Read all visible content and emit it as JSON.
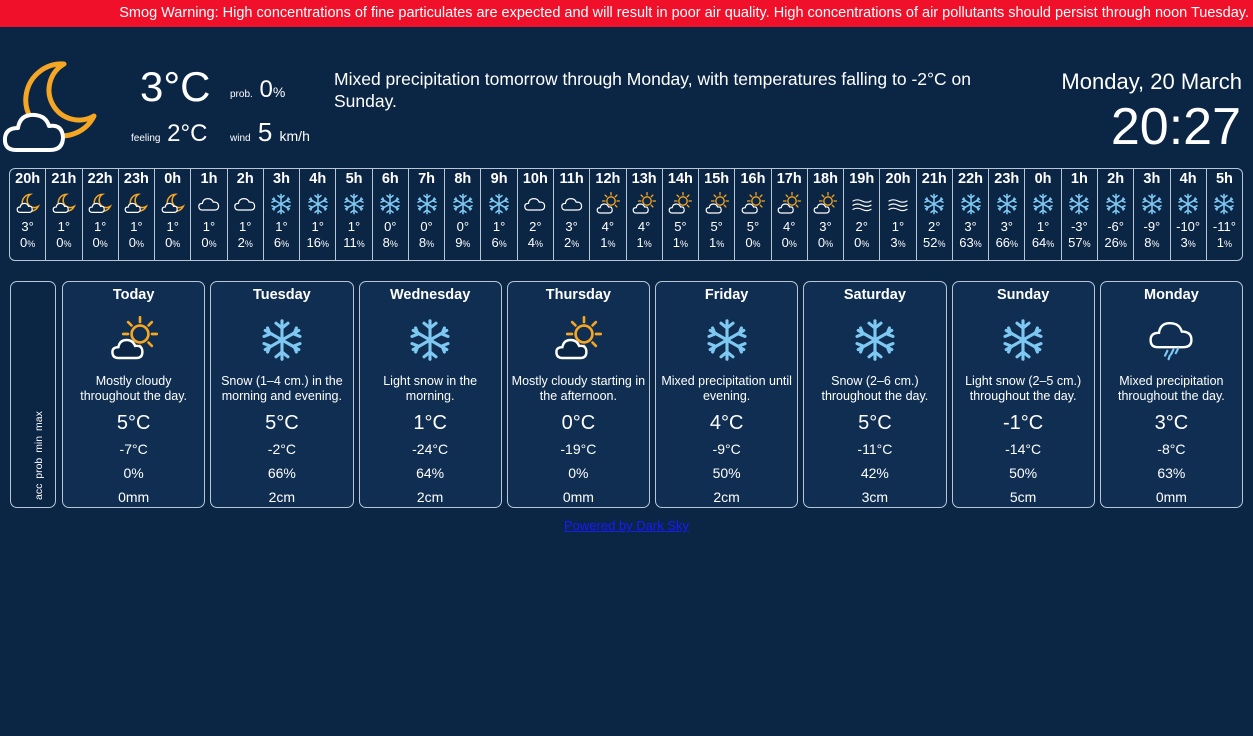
{
  "alert": {
    "text": "Smog Warning: High concentrations of fine particulates are expected and will result in poor air quality. High concentrations of air pollutants should persist through noon Tuesday."
  },
  "current": {
    "icon": "partly-cloudy-night-icon",
    "temperature": "3°C",
    "prob_label": "prob.",
    "prob_value": "0",
    "prob_unit": "%",
    "feeling_label": "feeling",
    "feeling_value": "2°C",
    "wind_label": "wind",
    "wind_value": "5",
    "wind_unit": "km/h"
  },
  "summary": "Mixed precipitation tomorrow through Monday, with temperatures falling to -2°C on Sunday.",
  "clock": {
    "date": "Monday, 20 March",
    "time": "20:27"
  },
  "hourly": [
    {
      "hour": "20h",
      "icon": "moon-cloud",
      "temp": "3°",
      "prob": "0"
    },
    {
      "hour": "21h",
      "icon": "moon-cloud",
      "temp": "1°",
      "prob": "0"
    },
    {
      "hour": "22h",
      "icon": "moon-cloud",
      "temp": "1°",
      "prob": "0"
    },
    {
      "hour": "23h",
      "icon": "moon-cloud",
      "temp": "1°",
      "prob": "0"
    },
    {
      "hour": "0h",
      "icon": "moon-cloud",
      "temp": "1°",
      "prob": "0"
    },
    {
      "hour": "1h",
      "icon": "cloud",
      "temp": "1°",
      "prob": "0"
    },
    {
      "hour": "2h",
      "icon": "cloud",
      "temp": "1°",
      "prob": "2"
    },
    {
      "hour": "3h",
      "icon": "snow",
      "temp": "1°",
      "prob": "6"
    },
    {
      "hour": "4h",
      "icon": "snow",
      "temp": "1°",
      "prob": "16"
    },
    {
      "hour": "5h",
      "icon": "snow",
      "temp": "1°",
      "prob": "11"
    },
    {
      "hour": "6h",
      "icon": "snow",
      "temp": "0°",
      "prob": "8"
    },
    {
      "hour": "7h",
      "icon": "snow",
      "temp": "0°",
      "prob": "8"
    },
    {
      "hour": "8h",
      "icon": "snow",
      "temp": "0°",
      "prob": "9"
    },
    {
      "hour": "9h",
      "icon": "snow",
      "temp": "1°",
      "prob": "6"
    },
    {
      "hour": "10h",
      "icon": "cloud",
      "temp": "2°",
      "prob": "4"
    },
    {
      "hour": "11h",
      "icon": "cloud",
      "temp": "3°",
      "prob": "2"
    },
    {
      "hour": "12h",
      "icon": "sun-cloud",
      "temp": "4°",
      "prob": "1"
    },
    {
      "hour": "13h",
      "icon": "sun-cloud",
      "temp": "4°",
      "prob": "1"
    },
    {
      "hour": "14h",
      "icon": "sun-cloud",
      "temp": "5°",
      "prob": "1"
    },
    {
      "hour": "15h",
      "icon": "sun-cloud",
      "temp": "5°",
      "prob": "1"
    },
    {
      "hour": "16h",
      "icon": "sun-cloud",
      "temp": "5°",
      "prob": "0"
    },
    {
      "hour": "17h",
      "icon": "sun-cloud",
      "temp": "4°",
      "prob": "0"
    },
    {
      "hour": "18h",
      "icon": "sun-cloud",
      "temp": "3°",
      "prob": "0"
    },
    {
      "hour": "19h",
      "icon": "fog",
      "temp": "2°",
      "prob": "0"
    },
    {
      "hour": "20h",
      "icon": "fog",
      "temp": "1°",
      "prob": "3"
    },
    {
      "hour": "21h",
      "icon": "snow",
      "temp": "2°",
      "prob": "52"
    },
    {
      "hour": "22h",
      "icon": "snow",
      "temp": "3°",
      "prob": "63"
    },
    {
      "hour": "23h",
      "icon": "snow",
      "temp": "3°",
      "prob": "66"
    },
    {
      "hour": "0h",
      "icon": "snow",
      "temp": "1°",
      "prob": "64"
    },
    {
      "hour": "1h",
      "icon": "snow",
      "temp": "-3°",
      "prob": "57"
    },
    {
      "hour": "2h",
      "icon": "snow",
      "temp": "-6°",
      "prob": "26"
    },
    {
      "hour": "3h",
      "icon": "snow",
      "temp": "-9°",
      "prob": "8"
    },
    {
      "hour": "4h",
      "icon": "snow",
      "temp": "-10°",
      "prob": "3"
    },
    {
      "hour": "5h",
      "icon": "snow",
      "temp": "-11°",
      "prob": "1"
    }
  ],
  "prob_unit": "%",
  "legend": {
    "text": "acc prob min max"
  },
  "daily": [
    {
      "name": "Today",
      "icon": "sun-cloud",
      "summary": "Mostly cloudy throughout the day.",
      "max": "5°C",
      "min": "-7°C",
      "prob": "0%",
      "acc": "0mm"
    },
    {
      "name": "Tuesday",
      "icon": "snow",
      "summary": "Snow (1–4 cm.) in the morning and evening.",
      "max": "5°C",
      "min": "-2°C",
      "prob": "66%",
      "acc": "2cm"
    },
    {
      "name": "Wednesday",
      "icon": "snow",
      "summary": "Light snow in the morning.",
      "max": "1°C",
      "min": "-24°C",
      "prob": "64%",
      "acc": "2cm"
    },
    {
      "name": "Thursday",
      "icon": "sun-cloud",
      "summary": "Mostly cloudy starting in the afternoon.",
      "max": "0°C",
      "min": "-19°C",
      "prob": "0%",
      "acc": "0mm"
    },
    {
      "name": "Friday",
      "icon": "snow",
      "summary": "Mixed precipitation until evening.",
      "max": "4°C",
      "min": "-9°C",
      "prob": "50%",
      "acc": "2cm"
    },
    {
      "name": "Saturday",
      "icon": "snow",
      "summary": "Snow (2–6 cm.) throughout the day.",
      "max": "5°C",
      "min": "-11°C",
      "prob": "42%",
      "acc": "3cm"
    },
    {
      "name": "Sunday",
      "icon": "snow",
      "summary": "Light snow (2–5 cm.) throughout the day.",
      "max": "-1°C",
      "min": "-14°C",
      "prob": "50%",
      "acc": "5cm"
    },
    {
      "name": "Monday",
      "icon": "sleet",
      "summary": "Mixed precipitation throughout the day.",
      "max": "3°C",
      "min": "-8°C",
      "prob": "63%",
      "acc": "0mm"
    }
  ],
  "powered_by": "Powered by Dark Sky",
  "colors": {
    "background": "#0b2545",
    "alert": "#f0102a",
    "sun": "#f5a623",
    "snow": "#7ec8f2",
    "border": "#b8c6d6",
    "link": "#1a1aff"
  }
}
